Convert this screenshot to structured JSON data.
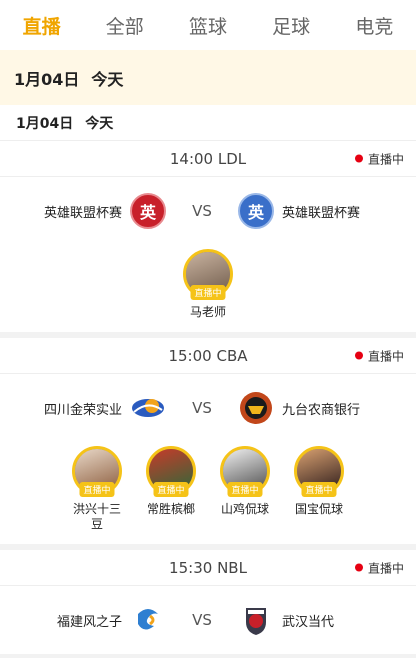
{
  "tabs": [
    {
      "label": "直播",
      "active": true
    },
    {
      "label": "全部",
      "active": false
    },
    {
      "label": "篮球",
      "active": false
    },
    {
      "label": "足球",
      "active": false
    },
    {
      "label": "电竞",
      "active": false
    }
  ],
  "sticky_date": {
    "date": "1月04日",
    "day": "今天"
  },
  "date_row": {
    "date": "1月04日",
    "day": "今天"
  },
  "live_label": "直播中",
  "vs_label": "VS",
  "matches": [
    {
      "time": "14:00",
      "league": "LDL",
      "home": {
        "name": "英雄联盟杯赛",
        "logo_text": "英",
        "logo_color": "#c8202a"
      },
      "away": {
        "name": "英雄联盟杯赛",
        "logo_text": "英",
        "logo_color": "#3a6fc9"
      },
      "streamers": [
        {
          "name": "马老师"
        }
      ]
    },
    {
      "time": "15:00",
      "league": "CBA",
      "home": {
        "name": "四川金荣实业",
        "logo_text": "",
        "logo_color": "#2a5bbf"
      },
      "away": {
        "name": "九台农商银行",
        "logo_text": "",
        "logo_color": "#c2471a"
      },
      "streamers": [
        {
          "name": "洪兴十三豆"
        },
        {
          "name": "常胜槟榔"
        },
        {
          "name": "山鸡侃球"
        },
        {
          "name": "国宝侃球"
        }
      ]
    },
    {
      "time": "15:30",
      "league": "NBL",
      "home": {
        "name": "福建风之子",
        "logo_text": "",
        "logo_color": "#2f7fd1"
      },
      "away": {
        "name": "武汉当代",
        "logo_text": "",
        "logo_color": "#3a3a4a"
      },
      "streamers": []
    }
  ]
}
